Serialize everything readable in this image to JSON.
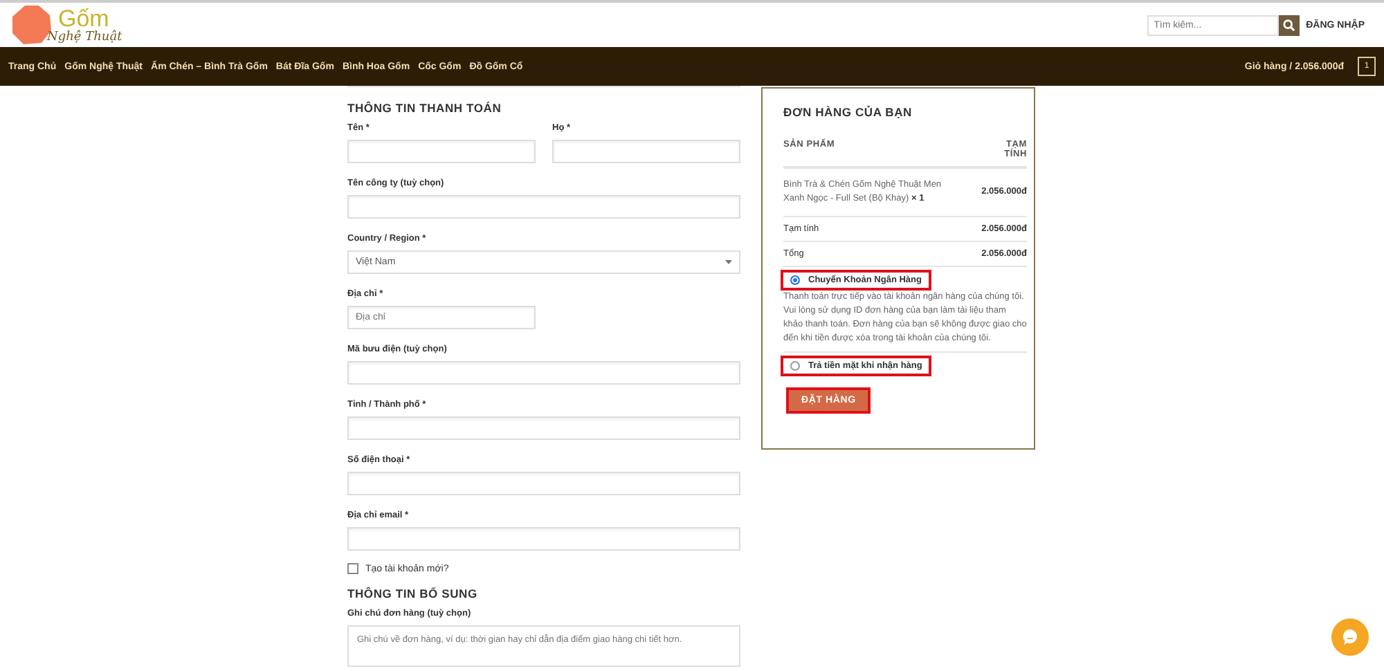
{
  "header": {
    "logo": {
      "title": "Gốm",
      "subtitle": "Nghệ Thuật"
    },
    "search": {
      "placeholder": "Tìm kiếm..."
    },
    "login": "ĐĂNG NHẬP"
  },
  "nav": {
    "items": [
      "Trang Chủ",
      "Gốm Nghệ Thuật",
      "Ấm Chén – Bình Trà Gốm",
      "Bát Đĩa Gốm",
      "Bình Hoa Gốm",
      "Cốc Gốm",
      "Đồ Gốm Cổ"
    ],
    "cart": {
      "label": "Giỏ hàng / 2.056.000đ",
      "count": "1"
    }
  },
  "billing": {
    "title": "THÔNG TIN THANH TOÁN",
    "fields": [
      {
        "label": "Tên *",
        "kind": "half"
      },
      {
        "label": "Họ *",
        "kind": "half"
      },
      {
        "label": "Tên công ty (tuỳ chọn)",
        "kind": "full"
      },
      {
        "label": "Country / Region *",
        "kind": "select",
        "value": "Việt Nam"
      },
      {
        "label": "Địa chỉ *",
        "kind": "half_alone",
        "placeholder": "Địa chỉ"
      },
      {
        "label": "Mã bưu điện (tuỳ chọn)",
        "kind": "full"
      },
      {
        "label": "Tỉnh / Thành phố *",
        "kind": "full"
      },
      {
        "label": "Số điện thoại *",
        "kind": "full"
      },
      {
        "label": "Địa chỉ email *",
        "kind": "full"
      }
    ],
    "create_account": {
      "label": "Tạo tài khoản mới?",
      "checked": false
    }
  },
  "additional": {
    "title": "THÔNG TIN BỔ SUNG",
    "notes_label": "Ghi chú đơn hàng (tuỳ chọn)",
    "placeholder": "Ghi chú về đơn hàng, ví dụ: thời gian hay chỉ dẫn địa điểm giao hàng chi tiết hơn."
  },
  "order": {
    "title": "ĐƠN HÀNG CỦA BẠN",
    "columns": [
      "SẢN PHẨM",
      "TẠM TÍNH"
    ],
    "items": [
      {
        "name": "Bình Trà & Chén Gốm Nghệ Thuật Men Xanh Ngọc - Full Set (Bộ Khay)",
        "qty": "× 1",
        "total": "2.056.000đ"
      }
    ],
    "totals": [
      {
        "label": "Tạm tính",
        "value": "2.056.000đ"
      },
      {
        "label": "Tổng",
        "value": "2.056.000đ"
      }
    ],
    "payment_methods": [
      {
        "label": "Chuyển Khoản Ngân Hàng",
        "selected": true,
        "highlighted": true,
        "description": "Thanh toán trực tiếp vào tài khoản ngân hàng của chúng tôi. Vui lòng sử dụng ID đơn hàng của bạn làm tài liệu tham khảo thanh toán. Đơn hàng của bạn sẽ không được giao cho đến khi tiền được xóa trong tài khoản của chúng tôi."
      },
      {
        "label": "Trả tiền mặt khi nhận hàng",
        "selected": false,
        "highlighted": true
      }
    ],
    "place_order": {
      "label": "ĐẶT HÀNG",
      "highlighted": true
    }
  }
}
